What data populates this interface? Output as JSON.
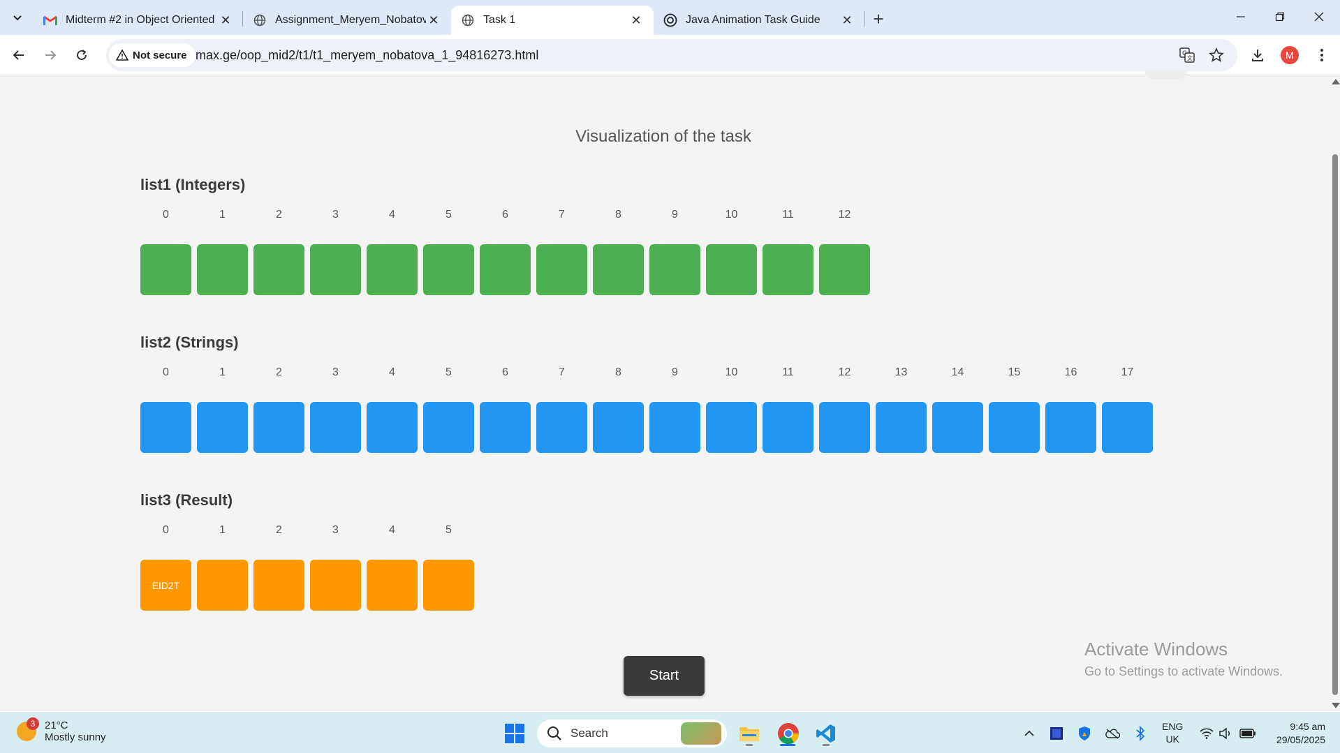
{
  "browser": {
    "tabs": [
      {
        "title": "Midterm #2 in Object Oriented",
        "icon": "gmail-icon",
        "active": false
      },
      {
        "title": "Assignment_Meryem_Nobatova",
        "icon": "globe-icon",
        "active": false
      },
      {
        "title": "Task 1",
        "icon": "globe-icon",
        "active": true
      },
      {
        "title": "Java Animation Task Guide",
        "icon": "chatgpt-icon",
        "active": false
      }
    ],
    "security_chip": "Not secure",
    "url": "max.ge/oop_mid2/t1/t1_meryem_nobatova_1_94816273.html",
    "profile_initial": "M"
  },
  "page": {
    "title": "Visualization of the task",
    "lists": [
      {
        "label": "list1 (Integers)",
        "color": "#4caf50",
        "indices": [
          "0",
          "1",
          "2",
          "3",
          "4",
          "5",
          "6",
          "7",
          "8",
          "9",
          "10",
          "11",
          "12"
        ],
        "values": [
          "",
          "",
          "",
          "",
          "",
          "",
          "",
          "",
          "",
          "",
          "",
          "",
          ""
        ]
      },
      {
        "label": "list2 (Strings)",
        "color": "#2196f3",
        "indices": [
          "0",
          "1",
          "2",
          "3",
          "4",
          "5",
          "6",
          "7",
          "8",
          "9",
          "10",
          "11",
          "12",
          "13",
          "14",
          "15",
          "16",
          "17"
        ],
        "values": [
          "",
          "",
          "",
          "",
          "",
          "",
          "",
          "",
          "",
          "",
          "",
          "",
          "",
          "",
          "",
          "",
          "",
          ""
        ]
      },
      {
        "label": "list3 (Result)",
        "color": "#ff9800",
        "indices": [
          "0",
          "1",
          "2",
          "3",
          "4",
          "5"
        ],
        "values": [
          "EID2T",
          "",
          "",
          "",
          "",
          ""
        ]
      }
    ],
    "start_label": "Start",
    "watermark": {
      "line1": "Activate Windows",
      "line2": "Go to Settings to activate Windows."
    }
  },
  "taskbar": {
    "weather_badge": "3",
    "temperature": "21°C",
    "condition": "Mostly sunny",
    "search_label": "Search",
    "language": {
      "line1": "ENG",
      "line2": "UK"
    },
    "time": "9:45 am",
    "date": "29/05/2025"
  }
}
